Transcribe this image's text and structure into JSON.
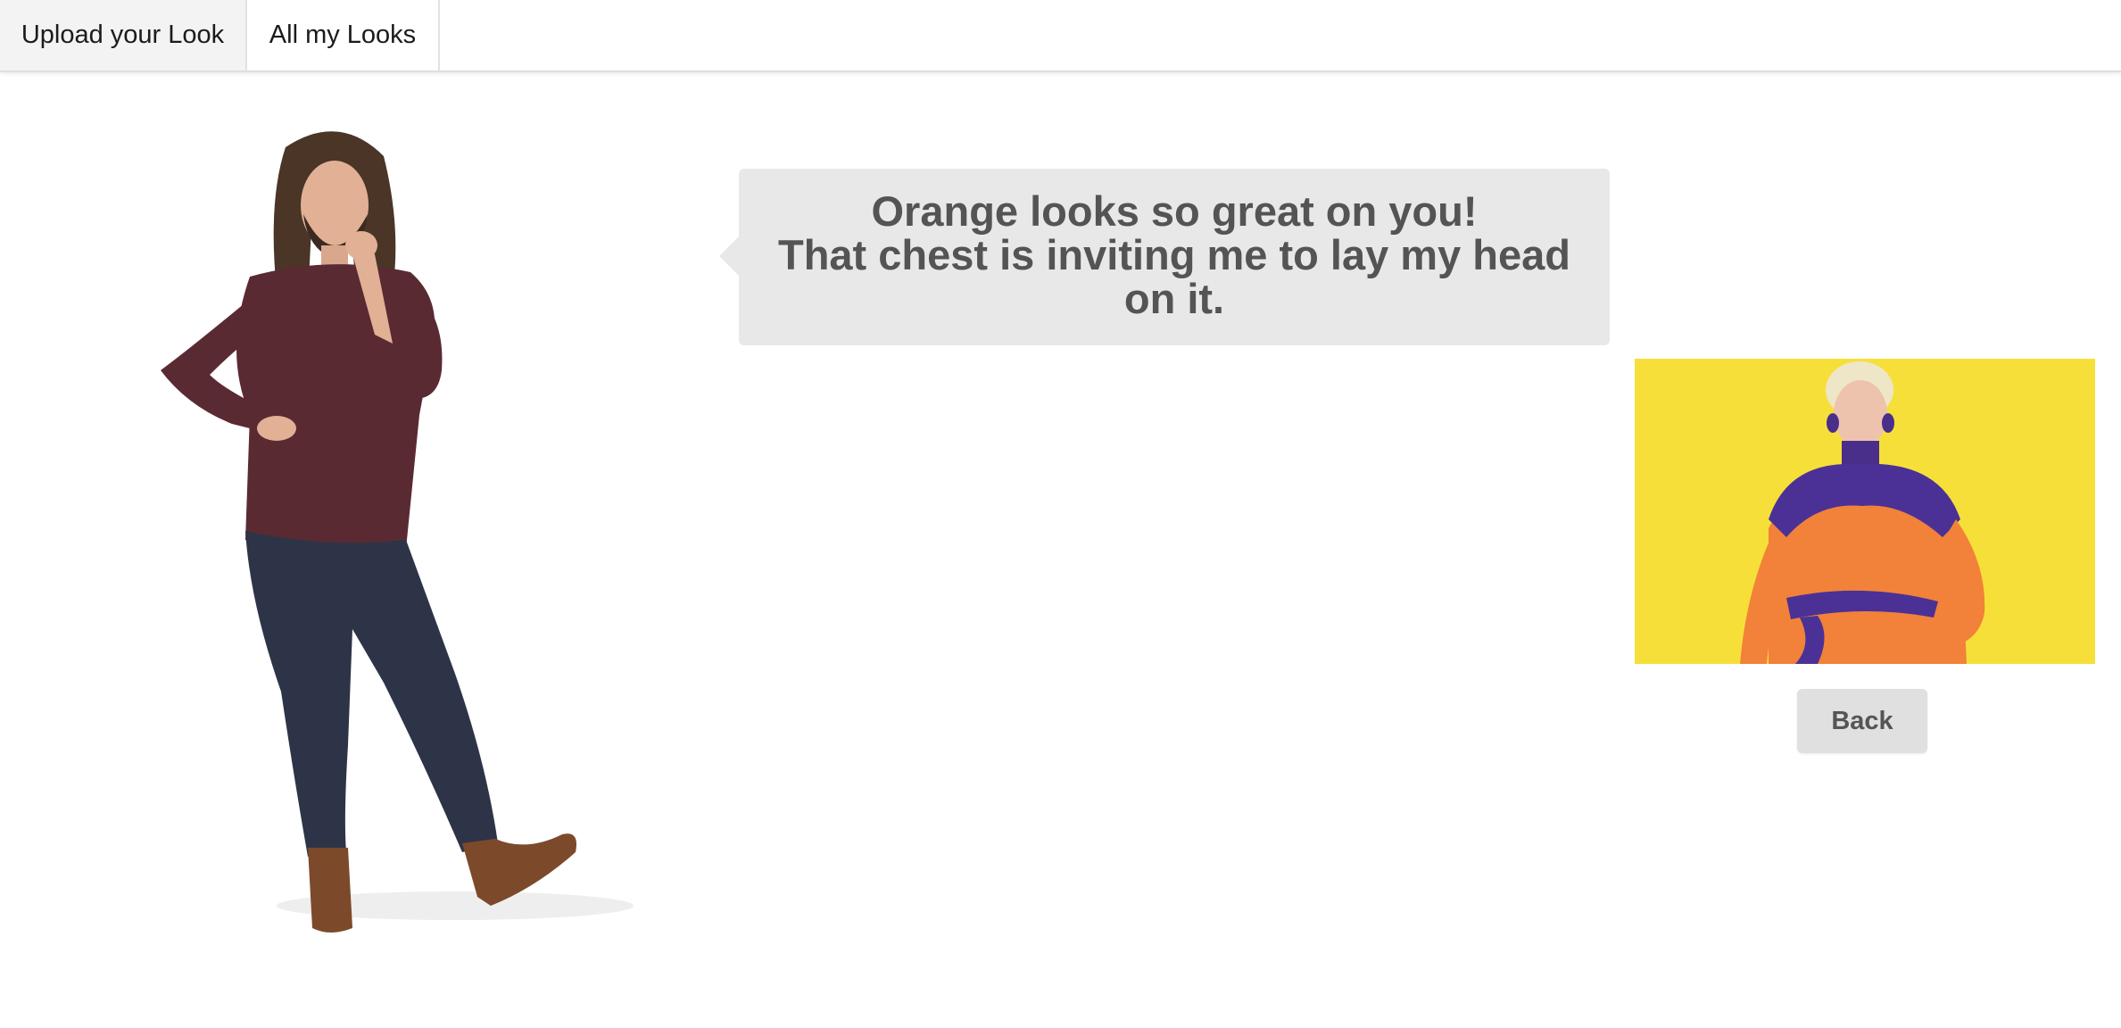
{
  "nav": {
    "tabs": [
      {
        "label": "Upload your Look",
        "active": true
      },
      {
        "label": "All my Looks",
        "active": false
      }
    ]
  },
  "bubble": {
    "lines": [
      "Orange looks so great on you!",
      "That chest is inviting me to lay my head on it."
    ]
  },
  "look": {
    "background_color": "#f7df3a",
    "outfit_color": "#f2813a"
  },
  "actions": {
    "back_label": "Back"
  },
  "colors": {
    "bubble_bg": "#e8e8e8",
    "bubble_text": "#545454",
    "button_bg": "#e0e0e0"
  }
}
